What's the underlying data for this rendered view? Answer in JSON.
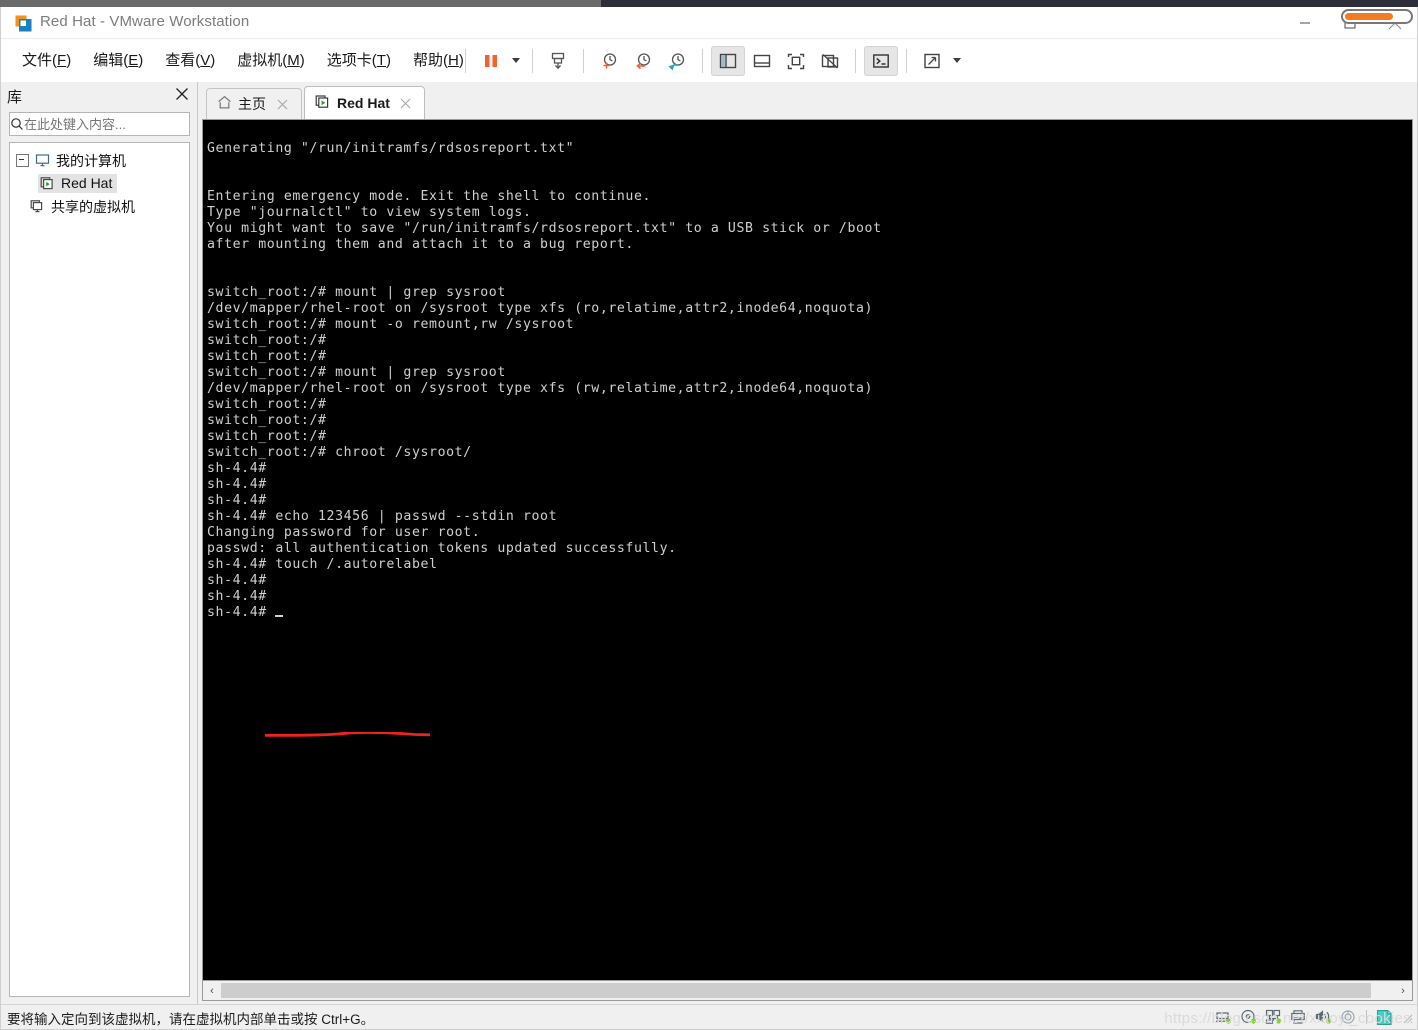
{
  "window": {
    "title": "Red Hat - VMware Workstation",
    "app_icon": "vmware-logo-icon",
    "minimize_label": "最小化",
    "maximize_label": "最大化",
    "close_label": "关闭"
  },
  "menubar": {
    "items": [
      {
        "name": "file",
        "text": "文件",
        "accel": "F"
      },
      {
        "name": "edit",
        "text": "编辑",
        "accel": "E"
      },
      {
        "name": "view",
        "text": "查看",
        "accel": "V"
      },
      {
        "name": "vm",
        "text": "虚拟机",
        "accel": "M"
      },
      {
        "name": "tabs",
        "text": "选项卡",
        "accel": "T"
      },
      {
        "name": "help",
        "text": "帮助",
        "accel": "H"
      }
    ]
  },
  "toolbar": {
    "buttons": [
      {
        "name": "pause-vm-button",
        "icon": "pause-icon",
        "selected": false
      },
      {
        "name": "power-dropdown",
        "icon": "chevron-down-icon",
        "selected": false
      },
      {
        "name": "snapshot-manage-button",
        "icon": "snapshot-icon",
        "selected": false
      },
      {
        "name": "take-snapshot-button",
        "icon": "snapshot-add-icon",
        "selected": false
      },
      {
        "name": "revert-snapshot-button",
        "icon": "snapshot-revert-icon",
        "selected": false
      },
      {
        "name": "snapshot-manager-button",
        "icon": "snapshot-wrench-icon",
        "selected": false
      },
      {
        "name": "show-library-button",
        "icon": "library-pane-icon",
        "selected": true
      },
      {
        "name": "show-thumbnail-bar-button",
        "icon": "thumbnail-bar-icon",
        "selected": false
      },
      {
        "name": "fullscreen-button",
        "icon": "fullscreen-icon",
        "selected": false
      },
      {
        "name": "unity-mode-button",
        "icon": "unity-mode-icon",
        "selected": false
      },
      {
        "name": "console-button",
        "icon": "terminal-icon",
        "selected": true
      },
      {
        "name": "stretch-button",
        "icon": "expand-arrows-icon",
        "selected": false
      },
      {
        "name": "stretch-dropdown",
        "icon": "chevron-down-icon",
        "selected": false
      }
    ]
  },
  "sidebar": {
    "title": "库",
    "close_label": "×",
    "search": {
      "placeholder": "在此处键入内容...",
      "value": "",
      "icon": "search-icon",
      "dropdown_icon": "chevron-down-icon"
    },
    "tree": [
      {
        "name": "my-computer",
        "label": "我的计算机",
        "icon": "computer-icon",
        "level": 1,
        "expanded": true,
        "selected": false
      },
      {
        "name": "red-hat-vm",
        "label": "Red Hat",
        "icon": "vm-running-icon",
        "level": 2,
        "selected": true
      },
      {
        "name": "shared-vms",
        "label": "共享的虚拟机",
        "icon": "shared-vm-icon",
        "level": 2,
        "selected": false
      }
    ]
  },
  "tabs": [
    {
      "name": "tab-home",
      "label": "主页",
      "icon": "home-icon",
      "active": false,
      "closable": true
    },
    {
      "name": "tab-red-hat",
      "label": "Red Hat",
      "icon": "vm-running-icon",
      "active": true,
      "closable": true
    }
  ],
  "terminal": {
    "background": "#000000",
    "foreground": "#cfcfcf",
    "lines": [
      "",
      "Generating \"/run/initramfs/rdsosreport.txt\"",
      "",
      "",
      "Entering emergency mode. Exit the shell to continue.",
      "Type \"journalctl\" to view system logs.",
      "You might want to save \"/run/initramfs/rdsosreport.txt\" to a USB stick or /boot",
      "after mounting them and attach it to a bug report.",
      "",
      "",
      "switch_root:/# mount | grep sysroot",
      "/dev/mapper/rhel-root on /sysroot type xfs (ro,relatime,attr2,inode64,noquota)",
      "switch_root:/# mount -o remount,rw /sysroot",
      "switch_root:/#",
      "switch_root:/#",
      "switch_root:/# mount | grep sysroot",
      "/dev/mapper/rhel-root on /sysroot type xfs (rw,relatime,attr2,inode64,noquota)",
      "switch_root:/#",
      "switch_root:/#",
      "switch_root:/#",
      "switch_root:/# chroot /sysroot/",
      "sh-4.4#",
      "sh-4.4#",
      "sh-4.4#",
      "sh-4.4# echo 123456 | passwd --stdin root",
      "Changing password for user root.",
      "passwd: all authentication tokens updated successfully.",
      "sh-4.4# touch /.autorelabel",
      "sh-4.4#",
      "sh-4.4#",
      "sh-4.4# "
    ],
    "cursor_line_index": 30,
    "annotation": {
      "name": "red-underline-annotation",
      "color": "#ee2222"
    }
  },
  "hscroll": {
    "left_arrow": "‹",
    "right_arrow": "›"
  },
  "statusbar": {
    "message": "要将输入定向到该虚拟机，请在虚拟机内部单击或按 Ctrl+G。",
    "icons": [
      {
        "name": "hard-disk-status-icon",
        "icon": "hard-disk-icon"
      },
      {
        "name": "cd-dvd-status-icon",
        "icon": "cd-dvd-icon"
      },
      {
        "name": "network-adapter-status-icon",
        "icon": "network-icon"
      },
      {
        "name": "printer-status-icon",
        "icon": "printer-icon"
      },
      {
        "name": "sound-card-status-icon",
        "icon": "speaker-icon"
      },
      {
        "name": "usb-status-icon",
        "icon": "usb-icon"
      },
      {
        "name": "message-log-icon",
        "icon": "note-icon"
      }
    ],
    "watermark": "https://blog.csdn.net/xiaoyi_cookies"
  }
}
